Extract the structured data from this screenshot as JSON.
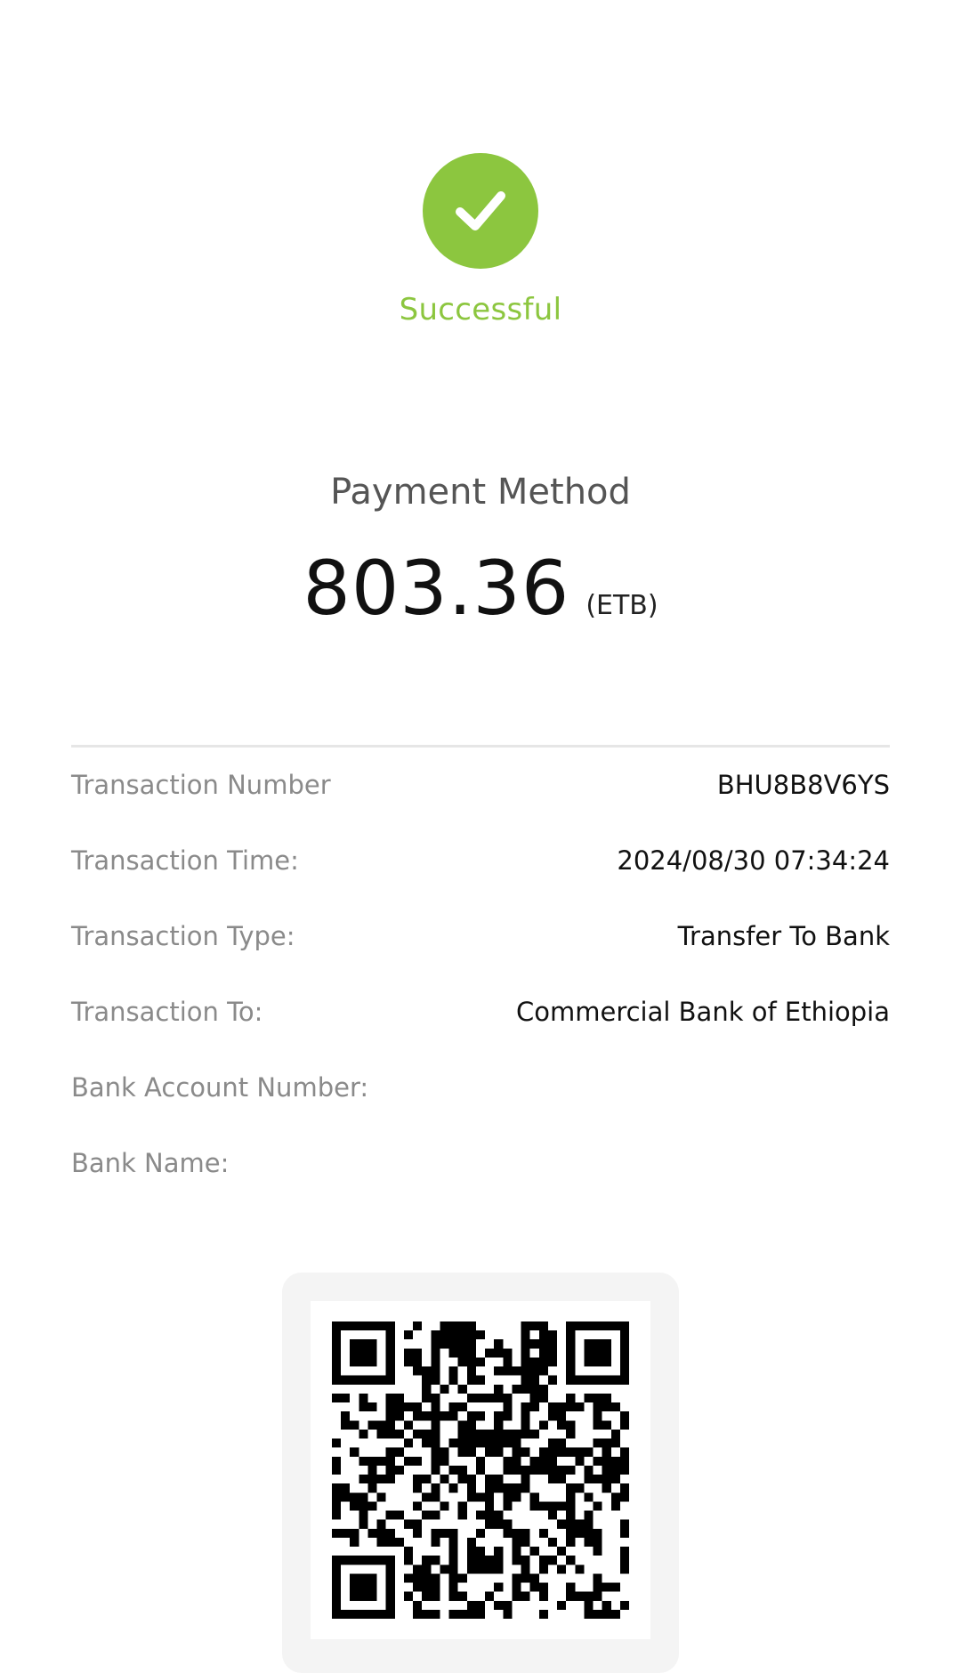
{
  "status": {
    "icon": "checkmark-icon",
    "text": "Successful",
    "color": "#8cc63f"
  },
  "payment": {
    "label": "Payment Method",
    "amount": "803.36",
    "currency": "(ETB)"
  },
  "details": [
    {
      "label": "Transaction Number",
      "value": "BHU8B8V6YS"
    },
    {
      "label": "Transaction Time:",
      "value": "2024/08/30 07:34:24"
    },
    {
      "label": "Transaction Type:",
      "value": "Transfer To Bank"
    },
    {
      "label": "Transaction To:",
      "value": "Commercial Bank of Ethiopia"
    },
    {
      "label": "Bank Account Number:",
      "value": ""
    },
    {
      "label": "Bank Name:",
      "value": ""
    }
  ],
  "qr": {
    "icon": "qr-code-icon"
  }
}
